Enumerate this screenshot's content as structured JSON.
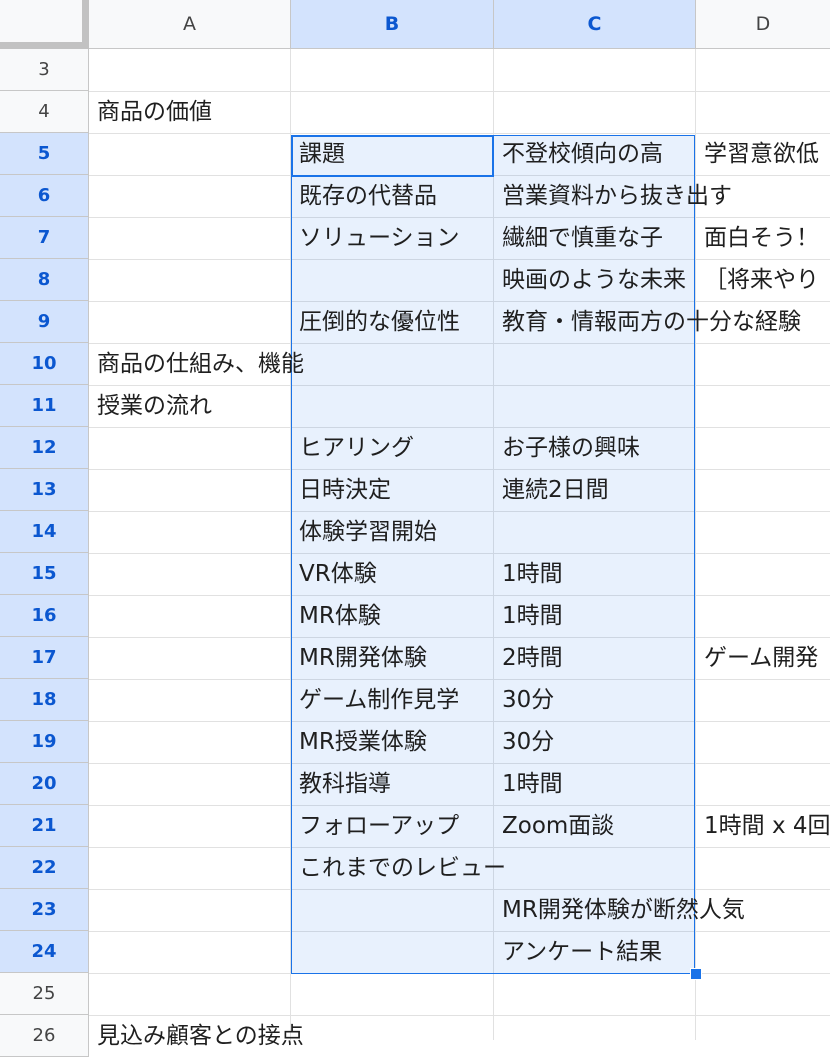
{
  "columns": [
    "A",
    "B",
    "C",
    "D"
  ],
  "rows": [
    "3",
    "4",
    "5",
    "6",
    "7",
    "8",
    "9",
    "10",
    "11",
    "12",
    "13",
    "14",
    "15",
    "16",
    "17",
    "18",
    "19",
    "20",
    "21",
    "22",
    "23",
    "24",
    "25",
    "26"
  ],
  "cells": {
    "A4": "商品の価値",
    "B5": "課題",
    "C5": "不登校傾向の高",
    "D5": "学習意欲低",
    "B6": "既存の代替品",
    "C6": "営業資料から抜き出す",
    "B7": "ソリューション",
    "C7": "繊細で慎重な子",
    "D7": "面白そう！",
    "C8": "映画のような未来",
    "D8": "［将来やり",
    "B9": "圧倒的な優位性",
    "C9": "教育・情報両方の十分な経験",
    "A10": "商品の仕組み、機能",
    "A11": "授業の流れ",
    "B12": "ヒアリング",
    "C12": "お子様の興味",
    "B13": "日時決定",
    "C13": "連続2日間",
    "B14": "体験学習開始",
    "B15": "VR体験",
    "C15": "1時間",
    "B16": "MR体験",
    "C16": "1時間",
    "B17": "MR開発体験",
    "C17": "2時間",
    "D17": "ゲーム開発",
    "B18": "ゲーム制作見学",
    "C18": "30分",
    "B19": "MR授業体験",
    "C19": "30分",
    "B20": "教科指導",
    "C20": "1時間",
    "B21": "フォローアップ",
    "C21": "Zoom面談",
    "D21": "1時間 x 4回",
    "B22": "これまでのレビュー",
    "C23": "MR開発体験が断然人気",
    "C24": "アンケート結果",
    "A26": "見込み顧客との接点"
  },
  "selection": {
    "range": "B5:C24",
    "active_cell": "B5"
  }
}
